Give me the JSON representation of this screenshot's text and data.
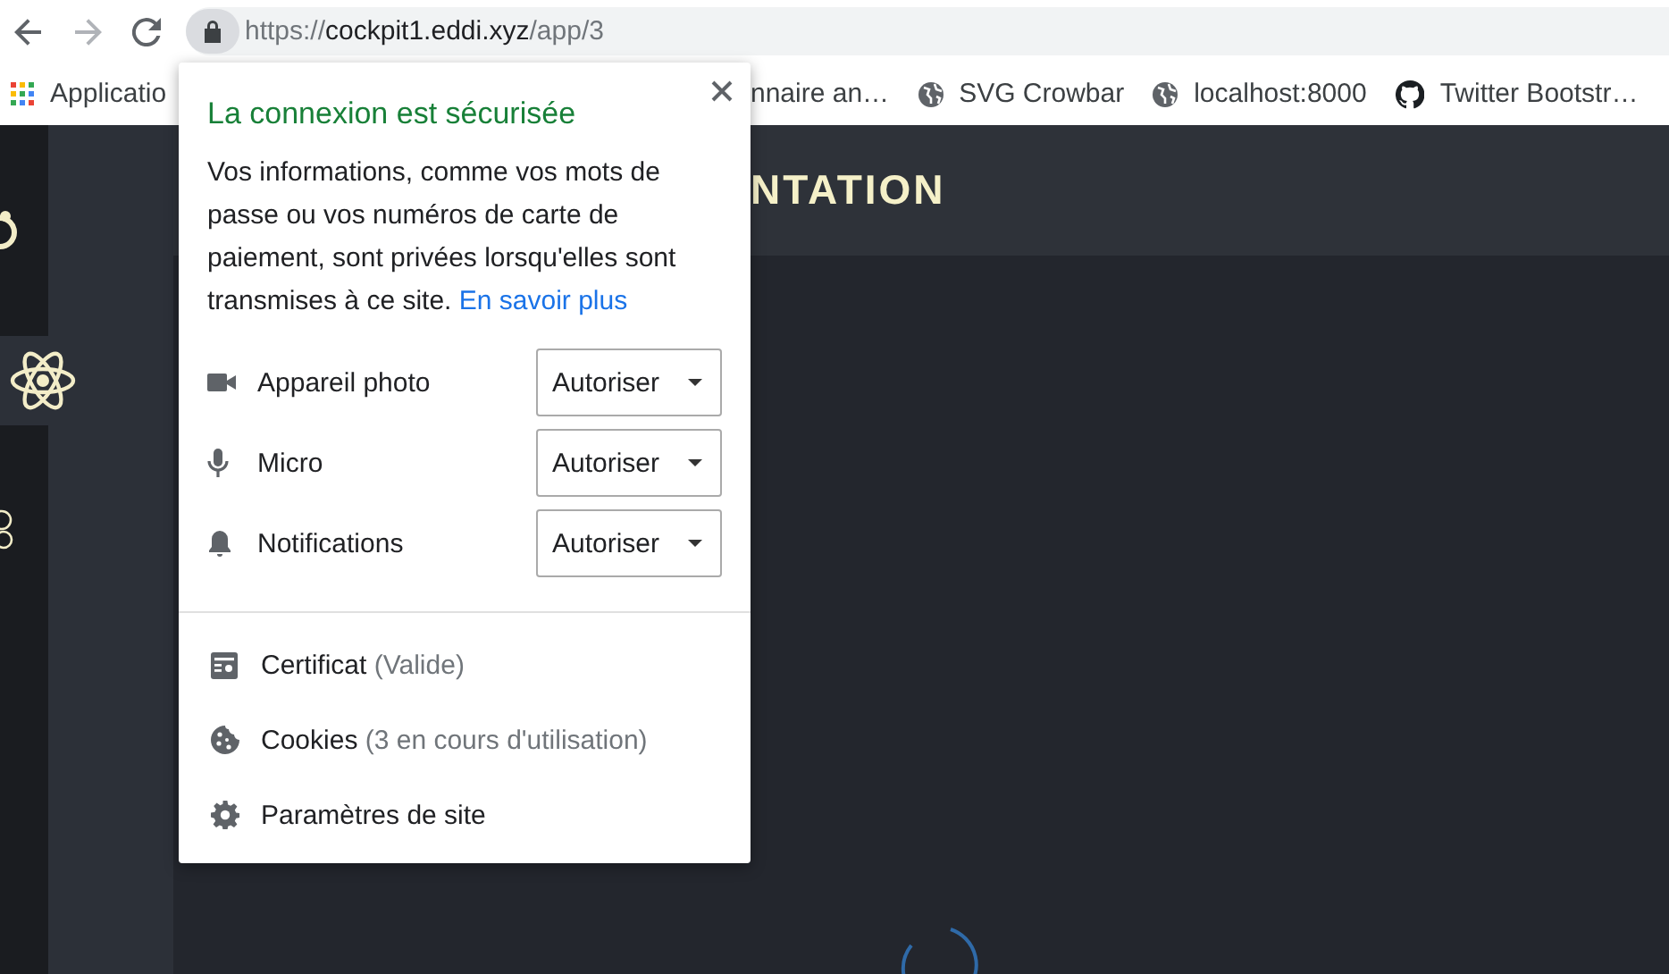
{
  "toolbar": {
    "url_scheme": "https://",
    "url_host": "cockpit1.eddi.xyz",
    "url_path": "/app/3"
  },
  "bookmarks": [
    {
      "label": "Applicatio"
    },
    {
      "label": "nnaire an…"
    },
    {
      "label": "SVG Crowbar"
    },
    {
      "label": "localhost:8000"
    },
    {
      "label": "Twitter Bootstr…"
    }
  ],
  "app": {
    "sidebar": [
      {
        "selected": false
      },
      {
        "selected": true
      },
      {
        "selected": false
      }
    ],
    "header_title": "NTATION"
  },
  "popup": {
    "title": "La connexion est sécurisée",
    "description": "Vos informations, comme vos mots de passe ou vos numéros de carte de paiement, sont privées lorsqu'elles sont transmises à ce site.",
    "link": "En savoir plus",
    "permissions": [
      {
        "label": "Appareil photo",
        "value": "Autoriser"
      },
      {
        "label": "Micro",
        "value": "Autoriser"
      },
      {
        "label": "Notifications",
        "value": "Autoriser"
      }
    ],
    "items": [
      {
        "label": "Certificat",
        "detail": "(Valide)"
      },
      {
        "label": "Cookies",
        "detail": "(3 en cours d'utilisation)"
      },
      {
        "label": "Paramètres de site"
      }
    ]
  }
}
